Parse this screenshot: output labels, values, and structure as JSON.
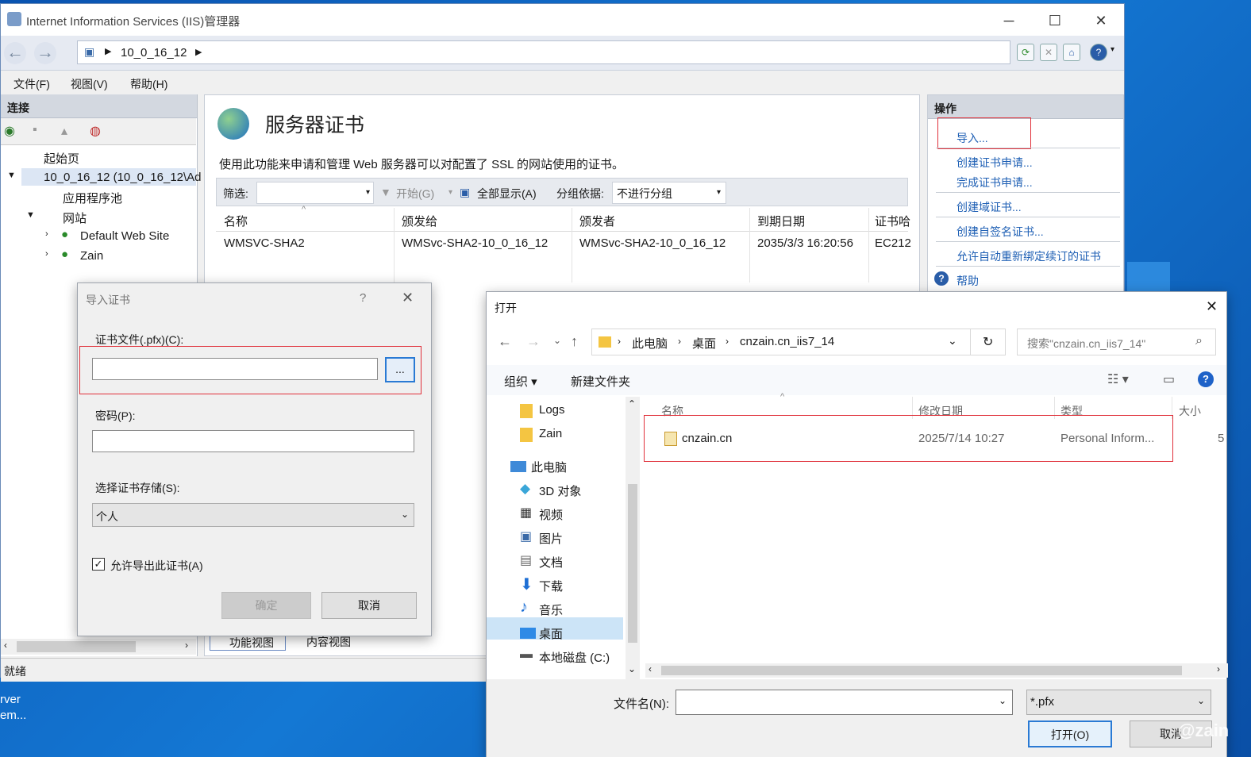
{
  "desktop": {
    "text1": "rver",
    "text2": "em...",
    "watermark": "@zain"
  },
  "iis": {
    "title": "Internet Information Services (IIS)管理器",
    "address": "10_0_16_12",
    "menu": [
      "文件(F)",
      "视图(V)",
      "帮助(H)"
    ],
    "connections": {
      "header": "连接",
      "items": [
        "起始页",
        "10_0_16_12 (10_0_16_12\\Ad",
        "应用程序池",
        "网站",
        "Default Web Site",
        "Zain"
      ]
    },
    "center": {
      "title": "服务器证书",
      "desc": "使用此功能来申请和管理 Web 服务器可以对配置了 SSL 的网站使用的证书。",
      "filter_label": "筛选:",
      "start": "开始(G)",
      "show_all": "全部显示(A)",
      "group_label": "分组依据:",
      "group_value": "不进行分组",
      "columns": [
        "名称",
        "颁发给",
        "颁发者",
        "到期日期",
        "证书哈"
      ],
      "rows": [
        [
          "WMSVC-SHA2",
          "WMSvc-SHA2-10_0_16_12",
          "WMSvc-SHA2-10_0_16_12",
          "2035/3/3 16:20:56",
          "EC212"
        ]
      ],
      "view_tabs": [
        "功能视图",
        "内容视图"
      ]
    },
    "actions": {
      "header": "操作",
      "items": [
        "导入...",
        "创建证书申请...",
        "完成证书申请...",
        "创建域证书...",
        "创建自签名证书...",
        "允许自动重新绑定续订的证书",
        "帮助"
      ]
    },
    "status": "就绪"
  },
  "import_dialog": {
    "title": "导入证书",
    "help": "?",
    "cert_label": "证书文件(.pfx)(C):",
    "cert_value": "",
    "browse": "...",
    "password_label": "密码(P):",
    "password_value": "",
    "store_label": "选择证书存储(S):",
    "store_value": "个人",
    "allow_export": "允许导出此证书(A)",
    "ok": "确定",
    "cancel": "取消"
  },
  "open_dialog": {
    "title": "打开",
    "breadcrumb": [
      "此电脑",
      "桌面",
      "cnzain.cn_iis7_14"
    ],
    "search_placeholder": "搜索\"cnzain.cn_iis7_14\"",
    "organize": "组织 ▾",
    "new_folder": "新建文件夹",
    "nav": [
      "Logs",
      "Zain",
      "此电脑",
      "3D 对象",
      "视频",
      "图片",
      "文档",
      "下载",
      "音乐",
      "桌面",
      "本地磁盘 (C:)"
    ],
    "columns": [
      "名称",
      "修改日期",
      "类型",
      "大小"
    ],
    "files": [
      {
        "name": "cnzain.cn",
        "date": "2025/7/14 10:27",
        "type": "Personal Inform...",
        "size": "5"
      }
    ],
    "filename_label": "文件名(N):",
    "filename_value": "",
    "filter": "*.pfx",
    "open": "打开(O)",
    "cancel": "取消"
  },
  "colors": {
    "accent": "#1e5fb4",
    "highlight": "#e0303a",
    "selected": "#cce4f7"
  }
}
